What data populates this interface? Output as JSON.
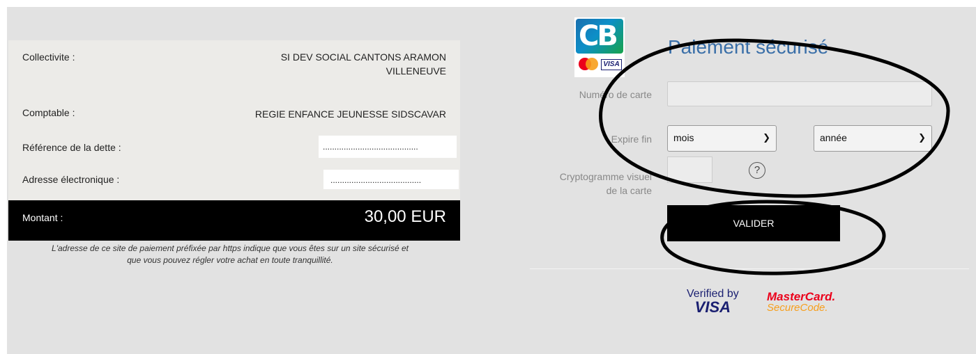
{
  "summary": {
    "rows": [
      {
        "label": "Collectivite :",
        "value_line1": "SI DEV SOCIAL CANTONS ARAMON",
        "value_line2": "VILLENEUVE"
      },
      {
        "label": "Comptable :",
        "value": "REGIE ENFANCE JEUNESSE SIDSCAVAR"
      },
      {
        "label": "Référence de la dette :",
        "value": "........................................."
      },
      {
        "label": "Adresse électronique :",
        "value": "......................................."
      }
    ],
    "amount_label": "Montant :",
    "amount_value": "30,00 EUR",
    "note_line1": "L'adresse de ce site de paiement préfixée par https indique que vous êtes sur un site sécurisé et",
    "note_line2": "que vous pouvez régler votre achat en toute tranquillité."
  },
  "form": {
    "logo_text": "CB",
    "logo_visa": "VISA",
    "title": "Paiement sécurisé",
    "card_number_label": "Numéro de carte",
    "card_number_value": "",
    "expiry_label": "Expire fin",
    "month_selected": "mois",
    "year_selected": "année",
    "cvv_label_line1": "Cryptogramme visuel",
    "cvv_label_line2": "de la carte",
    "cvv_value": "",
    "help_glyph": "?",
    "submit_label": "VALIDER"
  },
  "badges": {
    "visa_line1": "Verified by",
    "visa_line2": "VISA",
    "mc_line1": "MasterCard.",
    "mc_line2": "SecureCode."
  },
  "icons": {
    "dropdown": "chevron-down-icon",
    "help": "question-circle-icon"
  }
}
